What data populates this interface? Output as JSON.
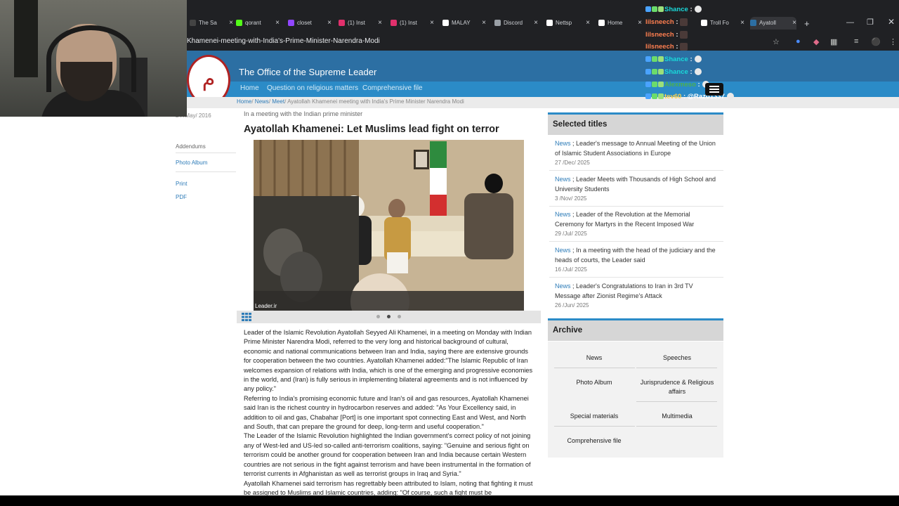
{
  "browser": {
    "tabs": [
      {
        "label": "The Sa",
        "color": "#444"
      },
      {
        "label": "qorant",
        "color": "#53fc18"
      },
      {
        "label": "closet",
        "color": "#9146ff"
      },
      {
        "label": "(1) Inst",
        "color": "#e1306c"
      },
      {
        "label": "(1) Inst",
        "color": "#e1306c"
      },
      {
        "label": "MALAY",
        "color": "#ffffff"
      },
      {
        "label": "Discord",
        "color": "#9aa0a6"
      },
      {
        "label": "Nettsp",
        "color": "#ffffff"
      },
      {
        "label": "Home",
        "color": "#ffffff"
      },
      {
        "label": "Troll Fo",
        "color": "#ffffff"
      },
      {
        "label": "Ayatoll",
        "color": "#2c6fa3"
      }
    ],
    "new_tab": "+",
    "url": "Khamenei-meeting-with-India's-Prime-Minister-Narendra-Modi"
  },
  "site": {
    "title": "The Office of the Supreme Leader",
    "logo_glyph": "م",
    "nav": [
      "Home",
      "Question on religious matters",
      "Comprehensive file"
    ],
    "breadcrumb": [
      "Home",
      "News",
      "Meet"
    ],
    "breadcrumb_current": "Ayatollah Khamenei meeting with India's Prime Minister Narendra Modi"
  },
  "left_sidebar": {
    "date": "24 /May/ 2016",
    "links": [
      "Addendums",
      "Photo Album",
      "Print",
      "PDF"
    ]
  },
  "article": {
    "kicker": "In a meeting with the Indian prime minister",
    "headline": "Ayatollah Khamenei: Let Muslims lead fight on terror",
    "photo_credit": "Leader.ir",
    "paragraphs": [
      "Leader of the Islamic Revolution Ayatollah Seyyed Ali Khamenei, in a meeting on Monday with Indian Prime Minister Narendra Modi, referred to the very long and historical background of cultural, economic and national communications between Iran and India, saying there are extensive grounds for cooperation between the two countries. Ayatollah Khamenei added:\"The Islamic Republic of Iran welcomes expansion of relations with India, which is one of the emerging and progressive economies in the world, and (Iran) is fully serious in implementing bilateral agreements and is not influenced by any policy.\"",
      "Referring to India's promising economic future and Iran's oil and gas resources, Ayatollah Khamenei said Iran is the richest country in hydrocarbon reserves and added: \"As Your Excellency said, in addition to oil and gas, Chabahar [Port] is one important spot connecting East and West, and North and South, that can prepare the ground for deep, long-term and useful cooperation.\"",
      "The Leader of the Islamic Revolution highlighted the Indian government's correct policy of not joining any of West-led and US-led so-called anti-terrorism coalitions, saying: \"Genuine and serious fight on terrorism could be another ground for cooperation between Iran and India because certain Western countries are not serious in the fight against terrorism and have been instrumental in the formation of terrorist currents in Afghanistan as well as terrorist groups in Iraq and Syria.\"",
      "Ayatollah Khamenei said terrorism has regrettably been attributed to Islam, noting that fighting it must be assigned to Muslims and Islamic countries, adding: \"Of course, such a fight must be"
    ]
  },
  "selected_titles": {
    "heading": "Selected titles",
    "items": [
      {
        "category": "News",
        "title": "Leader's message to Annual Meeting of the Union of Islamic Student Associations in Europe",
        "date": "27 /Dec/ 2025"
      },
      {
        "category": "News",
        "title": "Leader Meets with Thousands of High School and University Students",
        "date": "3 /Nov/ 2025"
      },
      {
        "category": "News",
        "title": "Leader of the Revolution at the Memorial Ceremony for Martyrs in the Recent Imposed War",
        "date": "29 /Jul/ 2025"
      },
      {
        "category": "News",
        "title": "In a meeting with the head of the judiciary and the heads of courts, the Leader said",
        "date": "16 /Jul/ 2025"
      },
      {
        "category": "News",
        "title": "Leader's Congratulations to Iran in 3rd TV Message after Zionist Regime's Attack",
        "date": "26 /Jun/ 2025"
      }
    ]
  },
  "archive": {
    "heading": "Archive",
    "items": [
      "News",
      "Speeches",
      "Photo Album",
      "Jurisprudence & Religious affairs",
      "Special materials",
      "Multimedia",
      "Comprehensive file"
    ]
  },
  "chat": [
    {
      "user": "Shance",
      "color": "#19d9d9",
      "sep": ":"
    },
    {
      "user": "lilsneech",
      "color": "#ff7f50",
      "sep": ":"
    },
    {
      "user": "lilsneech",
      "color": "#ff7f50",
      "sep": ":"
    },
    {
      "user": "lilsneech",
      "color": "#ff7f50",
      "sep": ":"
    },
    {
      "user": "Shance",
      "color": "#19d9d9",
      "sep": ":"
    },
    {
      "user": "Shance",
      "color": "#19d9d9",
      "sep": ":"
    },
    {
      "user": "Alexmeso",
      "color": "#4caf50",
      "sep": ":"
    },
    {
      "user": "tev60",
      "color": "#ffd24d",
      "sep": ": @Razo1337"
    }
  ]
}
